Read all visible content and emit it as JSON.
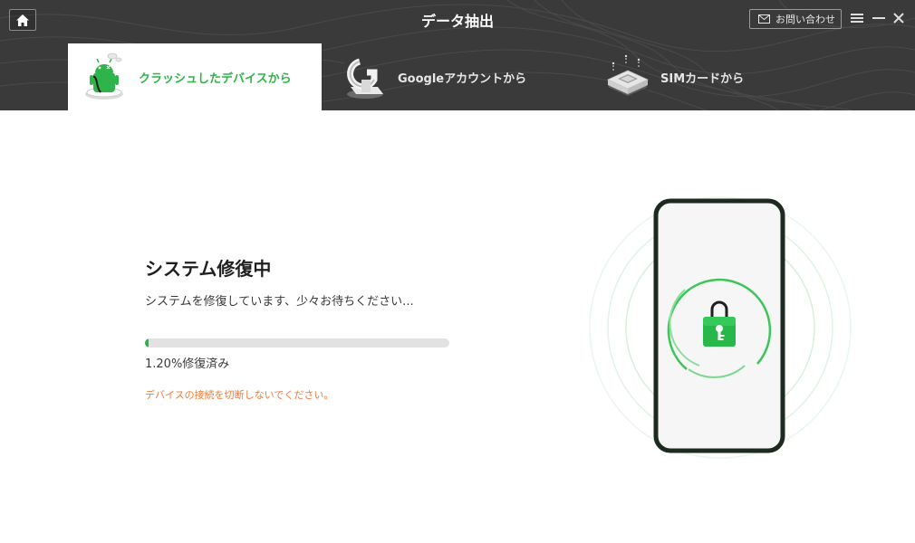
{
  "header": {
    "title": "データ抽出",
    "contact_label": "お問い合わせ"
  },
  "tabs": [
    {
      "label": "クラッシュしたデバイスから",
      "active": true,
      "icon": "android-device-icon"
    },
    {
      "label": "Googleアカウントから",
      "active": false,
      "icon": "google-account-icon"
    },
    {
      "label": "SIMカードから",
      "active": false,
      "icon": "sim-card-icon"
    }
  ],
  "main": {
    "title": "システム修復中",
    "description": "システムを修復しています、少々お待ちください...",
    "progress_percent": 1.2,
    "progress_text": "1.20%修復済み",
    "warning": "デバイスの接続を切断しないでください。"
  },
  "colors": {
    "accent": "#2fb44b",
    "header_bg": "#3a3a3a",
    "warning": "#ef7b3a"
  }
}
